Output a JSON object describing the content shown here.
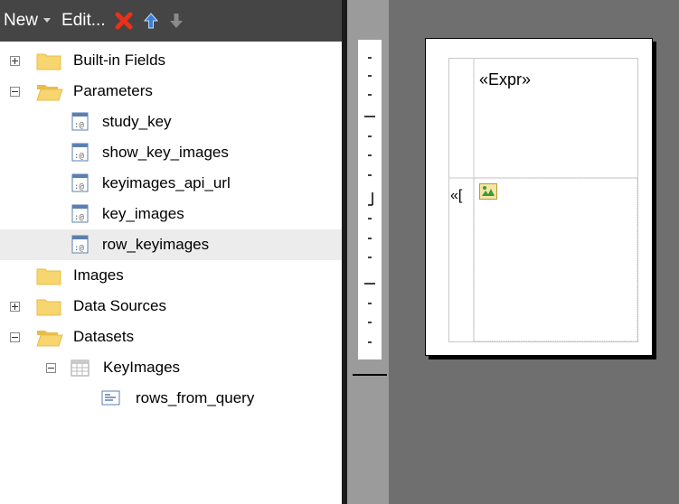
{
  "toolbar": {
    "new_label": "New",
    "edit_label": "Edit...",
    "delete_icon": "delete-icon",
    "move_up_icon": "move-up-icon",
    "move_down_icon": "move-down-icon"
  },
  "tree": {
    "built_in_fields": "Built-in Fields",
    "parameters": "Parameters",
    "params": [
      "study_key",
      "show_key_images",
      "keyimages_api_url",
      "key_images",
      "row_keyimages"
    ],
    "images": "Images",
    "data_sources": "Data Sources",
    "datasets": "Datasets",
    "dataset_name": "KeyImages",
    "query_name": "rows_from_query"
  },
  "design": {
    "expr_text": "«Expr»",
    "clipped_text": "«["
  },
  "colors": {
    "toolbar_bg": "#454545",
    "delete_red": "#e8311a",
    "arrow_blue": "#3a7fd9",
    "folder": "#f7d56f",
    "canvas_bg": "#6f6f6f"
  }
}
